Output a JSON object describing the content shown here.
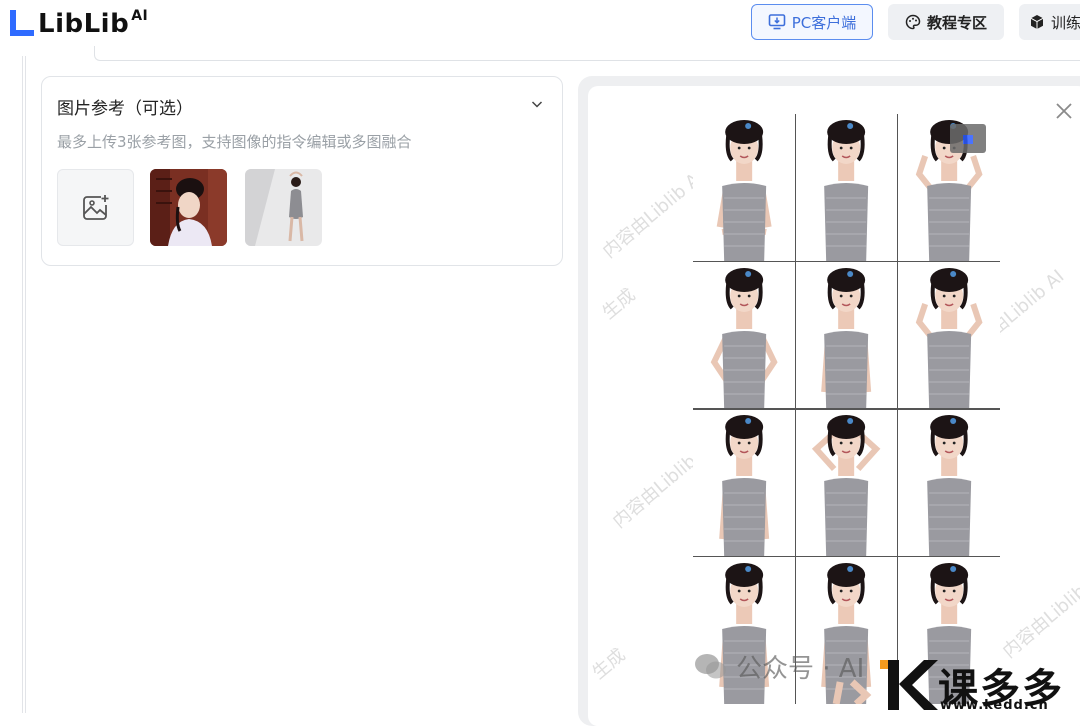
{
  "header": {
    "logo_text": "LibLib",
    "logo_sup": "AI",
    "pc_client_label": "PC客户端",
    "tutorial_label": "教程专区",
    "train_label": "训练"
  },
  "ref_panel": {
    "title": "图片参考（可选）",
    "description": "最多上传3张参考图，支持图像的指令编辑或多图融合"
  },
  "preview": {
    "watermark_texts": [
      "内容由Liblib AI",
      "生成",
      "内容由Liblib AI",
      "生成",
      "内容由Liblib AI",
      "生成",
      "内容由Liblib AI",
      "生成",
      "内容由Liblib AI",
      "生成"
    ],
    "grid_rows": 4,
    "grid_cols": 3
  },
  "overlay": {
    "wechat_text": "公众号 · AI",
    "site_name": "课多多",
    "site_url": "www.kedd.cn"
  },
  "colors": {
    "accent": "#3d6fdb",
    "logo_blue": "#2f6bff",
    "kedd_orange": "#f39a1e"
  }
}
